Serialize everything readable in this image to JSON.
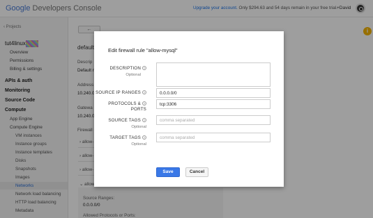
{
  "header": {
    "logo_google": "Google",
    "logo_rest": "Developers Console",
    "upgrade_link": "Upgrade your account.",
    "upgrade_text": "Only $294.63 and 54 days remain in your free trial.",
    "user": "+David"
  },
  "sidebar": {
    "back": "‹ Projects",
    "project": "tut4linux",
    "items": {
      "overview": "Overview",
      "permissions": "Permissions",
      "billing": "Billing & settings",
      "apis": "APIs & auth",
      "monitoring": "Monitoring",
      "source_code": "Source Code",
      "compute": "Compute",
      "app_engine": "App Engine",
      "compute_engine": "Compute Engine",
      "vm_instances": "VM instances",
      "instance_groups": "Instance groups",
      "instance_templates": "Instance templates",
      "disks": "Disks",
      "snapshots": "Snapshots",
      "images": "Images",
      "networks": "Networks",
      "network_lb": "Network load balancing",
      "http_lb": "HTTP load balancing",
      "metadata": "Metadata"
    }
  },
  "background": {
    "back_arrow": "←",
    "title": "default",
    "descr_label": "Descrip",
    "descr_value": "Default n",
    "address_label": "Address",
    "address_value": "10.240.0.",
    "gateway_label": "Gatewa",
    "gateway_value": "10.240.0.",
    "firewall_label": "Firewall r",
    "rules": [
      "allow-",
      "allow-",
      "allow-",
      "allow-"
    ],
    "source_ranges_label": "Source Ranges:",
    "source_ranges_value": "0.0.0.0/0",
    "allowed_label": "Allowed Protocols or Ports:"
  },
  "help_badge": "i",
  "dialog": {
    "title": "Edit firewall rule \"allow-mysql\"",
    "description_label": "DESCRIPTION",
    "optional": "Optional",
    "source_ip_label": "SOURCE IP RANGES",
    "source_ip_value": "0.0.0.0/0",
    "protocols_label_1": "PROTOCOLS &",
    "protocols_label_2": "PORTS",
    "protocols_value": "tcp:3306",
    "source_tags_label": "SOURCE TAGS",
    "source_tags_placeholder": "comma separated",
    "target_tags_label": "TARGET TAGS",
    "target_tags_placeholder": "comma separated",
    "help_glyph": "?",
    "save": "Save",
    "cancel": "Cancel"
  },
  "colors": {
    "accent": "#3a78e7",
    "help_badge": "#f4b400",
    "overlay": "rgba(0,0,0,0.38)"
  }
}
